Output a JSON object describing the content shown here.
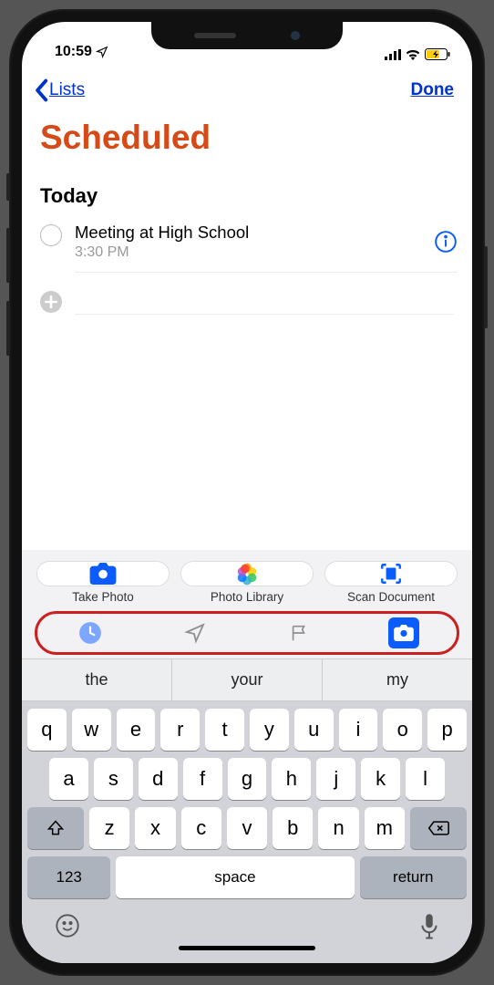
{
  "status": {
    "time": "10:59"
  },
  "nav": {
    "back": "Lists",
    "done": "Done"
  },
  "title": "Scheduled",
  "section": "Today",
  "reminders": [
    {
      "text": "Meeting at High School",
      "time": "3:30 PM"
    }
  ],
  "attachments": {
    "takephoto": "Take Photo",
    "photolibrary": "Photo Library",
    "scandoc": "Scan Document"
  },
  "suggestions": [
    "the",
    "your",
    "my"
  ],
  "keyboard": {
    "row1": [
      "q",
      "w",
      "e",
      "r",
      "t",
      "y",
      "u",
      "i",
      "o",
      "p"
    ],
    "row2": [
      "a",
      "s",
      "d",
      "f",
      "g",
      "h",
      "j",
      "k",
      "l"
    ],
    "row3": [
      "z",
      "x",
      "c",
      "v",
      "b",
      "n",
      "m"
    ],
    "numKey": "123",
    "space": "space",
    "ret": "return"
  }
}
